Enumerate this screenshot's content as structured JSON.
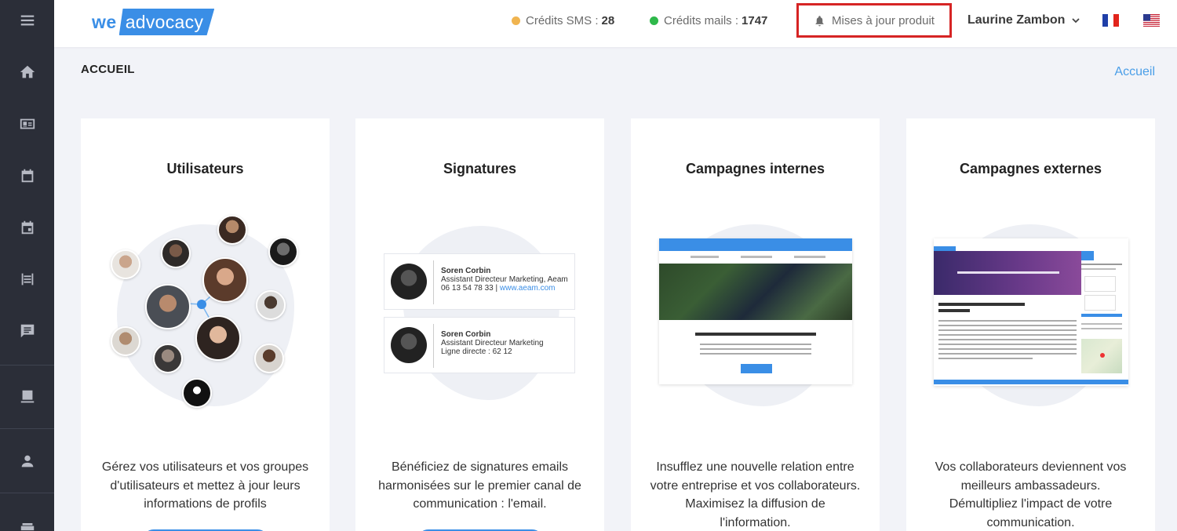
{
  "header": {
    "logo_we": "we",
    "logo_box": "advocacy",
    "sms_label": "Crédits SMS :",
    "sms_value": "28",
    "mail_label": "Crédits mails :",
    "mail_value": "1747",
    "updates_label": "Mises à jour produit",
    "user_name": "Laurine Zambon",
    "colors": {
      "sms_dot": "#f0b450",
      "mail_dot": "#2eb84a",
      "accent": "#3a8ee6",
      "highlight": "#d62424"
    }
  },
  "page": {
    "title": "ACCUEIL",
    "breadcrumb": "Accueil"
  },
  "sidebar": {
    "icons": [
      "menu-icon",
      "home-icon",
      "id-card-icon",
      "calendar-icon",
      "calendar-event-icon",
      "campaign-icon",
      "chat-icon",
      "screen-icon",
      "user-icon",
      "team-icon"
    ]
  },
  "cards": [
    {
      "title": "Utilisateurs",
      "desc": "Gérez vos utilisateurs et vos groupes d'utilisateurs et mettez à jour leurs informations de profils"
    },
    {
      "title": "Signatures",
      "desc": "Bénéficiez de signatures emails harmonisées sur le premier canal de communication : l'email."
    },
    {
      "title": "Campagnes internes",
      "desc": "Insufflez une nouvelle relation entre votre entreprise et vos collaborateurs. Maximisez la diffusion de l'information."
    },
    {
      "title": "Campagnes externes",
      "desc": "Vos collaborateurs deviennent vos meilleurs ambassadeurs. Démultipliez l'impact de votre communication."
    }
  ],
  "signatures": {
    "sig1": {
      "name": "Soren Corbin",
      "role": "Assistant Directeur Marketing, Aeam",
      "phone": "06 13 54 78 33 |",
      "site": "www.aeam.com"
    },
    "sig2": {
      "name": "Soren Corbin",
      "role": "Assistant Directeur Marketing",
      "phone": "Ligne directe : 62 12"
    }
  }
}
